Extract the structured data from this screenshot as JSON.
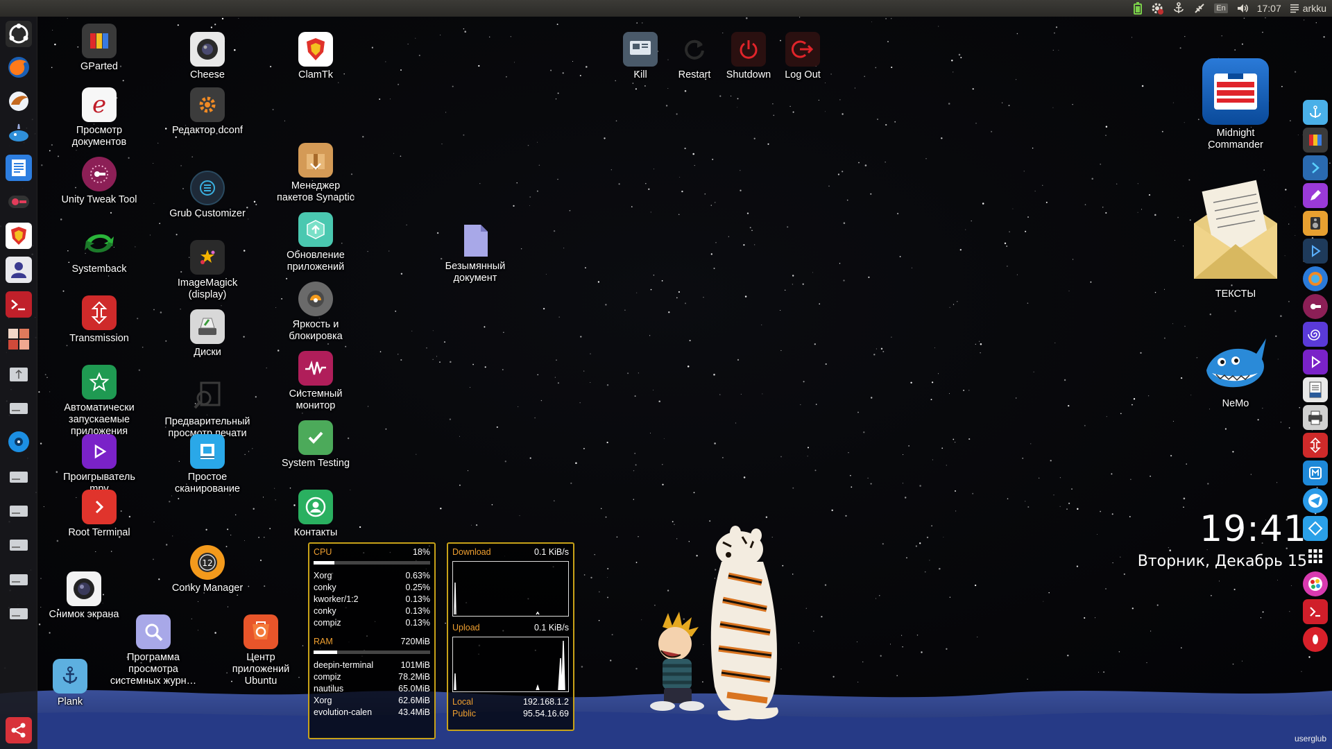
{
  "panel": {
    "keyboard_layout": "En",
    "time": "17:07",
    "user": "arkku"
  },
  "desktop_icons": {
    "gparted": "GParted",
    "cheese": "Cheese",
    "clamtk": "ClamTk",
    "kill": "Kill",
    "restart": "Restart",
    "shutdown": "Shutdown",
    "logout": "Log Out",
    "doc_viewer": "Просмотр\nдокументов",
    "dconf": "Редактор dconf",
    "synaptic": "Менеджер\nпакетов Synaptic",
    "unity_tweak": "Unity Tweak Tool",
    "grub_customizer": "Grub Customizer",
    "software_updater": "Обновление\nприложений",
    "untitled_doc": "Безымянный\nдокумент",
    "systemback": "Systemback",
    "imagemagick": "ImageMagick\n(display)",
    "brightness_lock": "Яркость и\nблокировка",
    "transmission": "Transmission",
    "disks": "Диски",
    "system_monitor": "Системный\nмонитор",
    "autostart": "Автоматически\nзапускаемые\nприложения",
    "print_preview": "Предварительный\nпросмотр печати",
    "system_testing": "System Testing",
    "mpv": "Проигрыватель\nmpv",
    "simple_scan": "Простое\nсканирование",
    "root_terminal": "Root Terminal",
    "contacts": "Контакты",
    "conky_manager": "Conky Manager",
    "screenshot": "Снимок экрана",
    "log_viewer": "Программа\nпросмотра\nсистемных журн…",
    "ubuntu_software": "Центр\nприложений\nUbuntu",
    "plank": "Plank",
    "midnight_commander": "Midnight\nCommander",
    "texts": "ТЕКСТЫ",
    "nemo": "NeMo"
  },
  "conky_cpu": {
    "cpu_label": "CPU",
    "cpu_value": "18%",
    "cpu_fraction": 0.18,
    "processes": [
      {
        "name": "Xorg",
        "value": "0.63%"
      },
      {
        "name": "conky",
        "value": "0.25%"
      },
      {
        "name": "kworker/1:2",
        "value": "0.13%"
      },
      {
        "name": "conky",
        "value": "0.13%"
      },
      {
        "name": "compiz",
        "value": "0.13%"
      }
    ],
    "ram_label": "RAM",
    "ram_value": "720MiB",
    "ram_fraction": 0.2,
    "memory": [
      {
        "name": "deepin-terminal",
        "value": "101MiB"
      },
      {
        "name": "compiz",
        "value": "78.2MiB"
      },
      {
        "name": "nautilus",
        "value": "65.0MiB"
      },
      {
        "name": "Xorg",
        "value": "62.6MiB"
      },
      {
        "name": "evolution-calen",
        "value": "43.4MiB"
      }
    ]
  },
  "conky_net": {
    "download_label": "Download",
    "download_value": "0.1 KiB/s",
    "upload_label": "Upload",
    "upload_value": "0.1 KiB/s",
    "local_label": "Local",
    "local_value": "192.168.1.2",
    "public_label": "Public",
    "public_value": "95.54.16.69"
  },
  "clock": {
    "time": "19:41",
    "date": "Вторник, Декабрь 15"
  },
  "watermark": "userglub"
}
